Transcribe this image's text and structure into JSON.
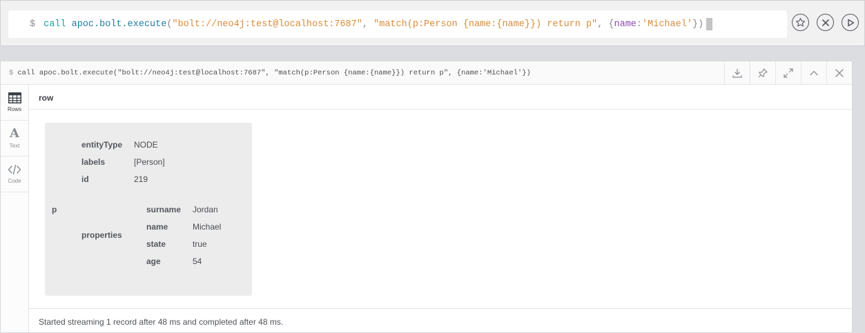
{
  "editor": {
    "prompt": "$",
    "tokens": {
      "kw": "call",
      "fn": "apoc.bolt.execute",
      "open": "(",
      "str1": "\"bolt://neo4j:test@localhost:7687\"",
      "comma1": ", ",
      "str2": "\"match(p:Person {name:{name}}) return p\"",
      "comma2": ", ",
      "brace_open": "{",
      "prop": "name",
      "colon": ":",
      "str3": "'Michael'",
      "brace_close": "})"
    }
  },
  "editor_actions": {
    "favorite_icon": "star-icon",
    "clear_icon": "close-circle-icon",
    "run_icon": "play-icon"
  },
  "frame": {
    "prompt": "$",
    "command": "call apoc.bolt.execute(\"bolt://neo4j:test@localhost:7687\", \"match(p:Person {name:{name}}) return p\", {name:'Michael'})",
    "tools": [
      "download-icon",
      "pin-icon",
      "expand-icon",
      "collapse-icon",
      "close-icon"
    ]
  },
  "sidebar": {
    "items": [
      {
        "label": "Rows",
        "icon": "table-icon",
        "active": true
      },
      {
        "label": "Text",
        "icon": "text-icon",
        "active": false
      },
      {
        "label": "Code",
        "icon": "code-icon",
        "active": false
      }
    ]
  },
  "table": {
    "column": "row",
    "record": {
      "key": "p",
      "entityType_label": "entityType",
      "entityType_value": "NODE",
      "labels_label": "labels",
      "labels_value": "[Person]",
      "id_label": "id",
      "id_value": "219",
      "properties_label": "properties",
      "properties": [
        {
          "key": "surname",
          "value": "Jordan"
        },
        {
          "key": "name",
          "value": "Michael"
        },
        {
          "key": "state",
          "value": "true"
        },
        {
          "key": "age",
          "value": "54"
        }
      ]
    }
  },
  "status": {
    "text": "Started streaming 1 record after 48 ms and completed after 48 ms."
  }
}
